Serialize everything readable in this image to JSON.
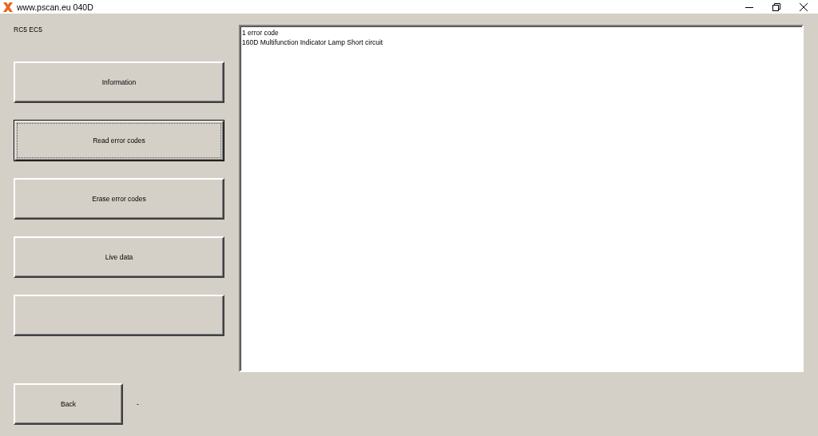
{
  "window": {
    "title": "www.pscan.eu 040D"
  },
  "module_label": "RC5 EC5",
  "buttons": [
    {
      "label": "Information",
      "focused": false
    },
    {
      "label": "Read error codes",
      "focused": true
    },
    {
      "label": "Erase error codes",
      "focused": false
    },
    {
      "label": "Live data",
      "focused": false
    },
    {
      "focused": false
    }
  ],
  "output": {
    "lines": [
      "1 error code",
      "160D Multifunction Indicator Lamp Short circuit"
    ]
  },
  "back_button": {
    "label": "Back",
    "focused": false
  },
  "status": "-"
}
